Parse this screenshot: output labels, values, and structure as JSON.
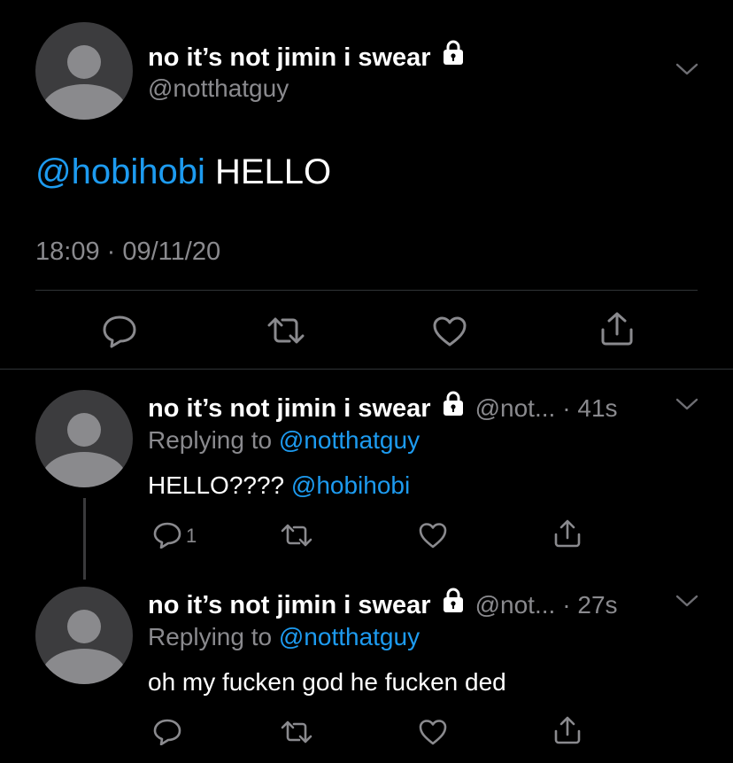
{
  "main_tweet": {
    "display_name": "no it’s not jimin i swear",
    "handle": "@notthatguy",
    "mention": "@hobihobi",
    "text": " HELLO",
    "timestamp": "18:09 · 09/11/20"
  },
  "replies": [
    {
      "display_name": "no it’s not jimin i swear",
      "handle": "@not...",
      "age": "· 41s",
      "replying_prefix": "Replying to ",
      "replying_to": "@notthatguy",
      "text": "HELLO???? ",
      "mention": "@hobihobi",
      "reply_count": "1"
    },
    {
      "display_name": "no it’s not jimin i swear",
      "handle": "@not...",
      "age": "· 27s",
      "replying_prefix": "Replying to ",
      "replying_to": "@notthatguy",
      "text": "oh my fucken god he fucken ded"
    }
  ],
  "icons": [
    "reply-icon",
    "retweet-icon",
    "like-icon",
    "share-icon",
    "lock-icon",
    "chevron-down-icon",
    "avatar-placeholder"
  ],
  "colors": {
    "background": "#000000",
    "link": "#1d9bf0",
    "secondary_text": "#8a8a8e",
    "divider": "#2f3336"
  }
}
